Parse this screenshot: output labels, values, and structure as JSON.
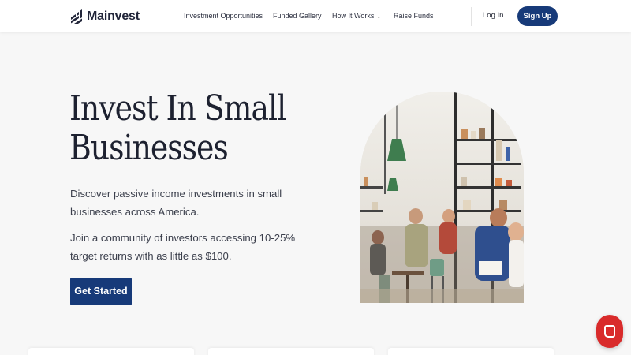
{
  "header": {
    "logo_text": "Mainvest",
    "nav": [
      {
        "label": "Investment Opportunities"
      },
      {
        "label": "Funded Gallery"
      },
      {
        "label": "How It Works"
      },
      {
        "label": "Raise Funds"
      }
    ],
    "login_label": "Log In",
    "signup_label": "Sign Up"
  },
  "hero": {
    "title_line1": "Invest In Small",
    "title_line2": "Businesses",
    "paragraph1": "Discover passive income investments in small businesses across America.",
    "paragraph2": "Join a community of investors accessing 10-25% target returns with as little as $100.",
    "cta_label": "Get Started"
  },
  "chat": {
    "icon": "chat-icon"
  },
  "colors": {
    "brand_navy": "#173a79",
    "chat_red": "#d92b2b",
    "background": "#f7f7f7"
  }
}
